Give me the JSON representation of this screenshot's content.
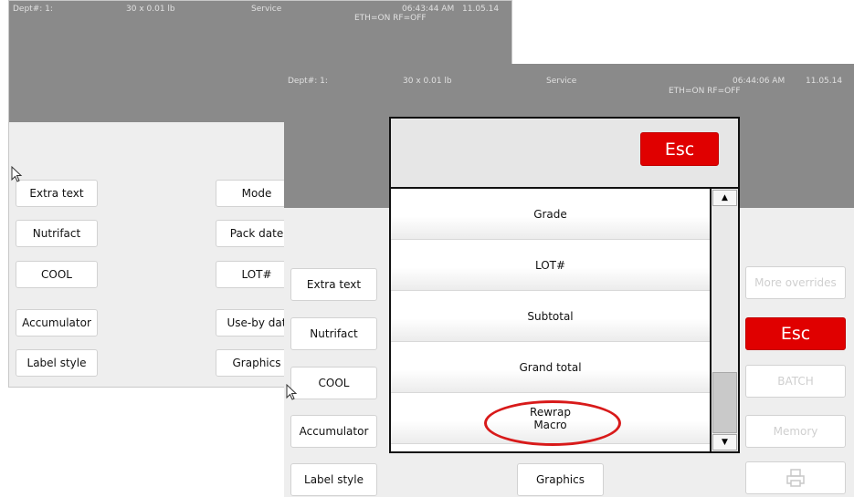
{
  "back_screen": {
    "status": {
      "dept": "Dept#: 1:",
      "scale": "30 x 0.01 lb",
      "mode": "Service",
      "time": "06:43:44 AM",
      "date": "11.05.14",
      "net": "ETH=ON RF=OFF"
    },
    "left_buttons": [
      "Extra text",
      "Nutrifact",
      "COOL",
      "Accumulator",
      "Label style"
    ],
    "right_buttons": [
      "Mode",
      "Pack date",
      "LOT#",
      "Use-by dat",
      "Graphics"
    ]
  },
  "front_screen": {
    "status": {
      "dept": "Dept#: 1:",
      "scale": "30 x 0.01 lb",
      "mode": "Service",
      "time": "06:44:06 AM",
      "date": "11.05.14",
      "net": "ETH=ON RF=OFF"
    },
    "left_buttons": [
      "Extra text",
      "Nutrifact",
      "COOL",
      "Accumulator",
      "Label style"
    ],
    "bottom_button": "Graphics",
    "right_buttons": {
      "more_overrides": "More overrides",
      "esc": "Esc",
      "batch": "BATCH",
      "memory": "Memory"
    }
  },
  "dialog": {
    "esc_label": "Esc",
    "items": [
      "Grade",
      "LOT#",
      "Subtotal",
      "Grand total",
      "Rewrap\nMacro"
    ],
    "highlighted_item": "Rewrap\nMacro"
  },
  "colors": {
    "header": "#8a8a8a",
    "panel": "#eeeeee",
    "accent_red": "#e00000",
    "highlight_ring": "#d81a1a"
  },
  "icons": [
    "mouse-pointer-icon",
    "printer-icon",
    "scroll-up-arrow-icon",
    "scroll-down-arrow-icon"
  ]
}
